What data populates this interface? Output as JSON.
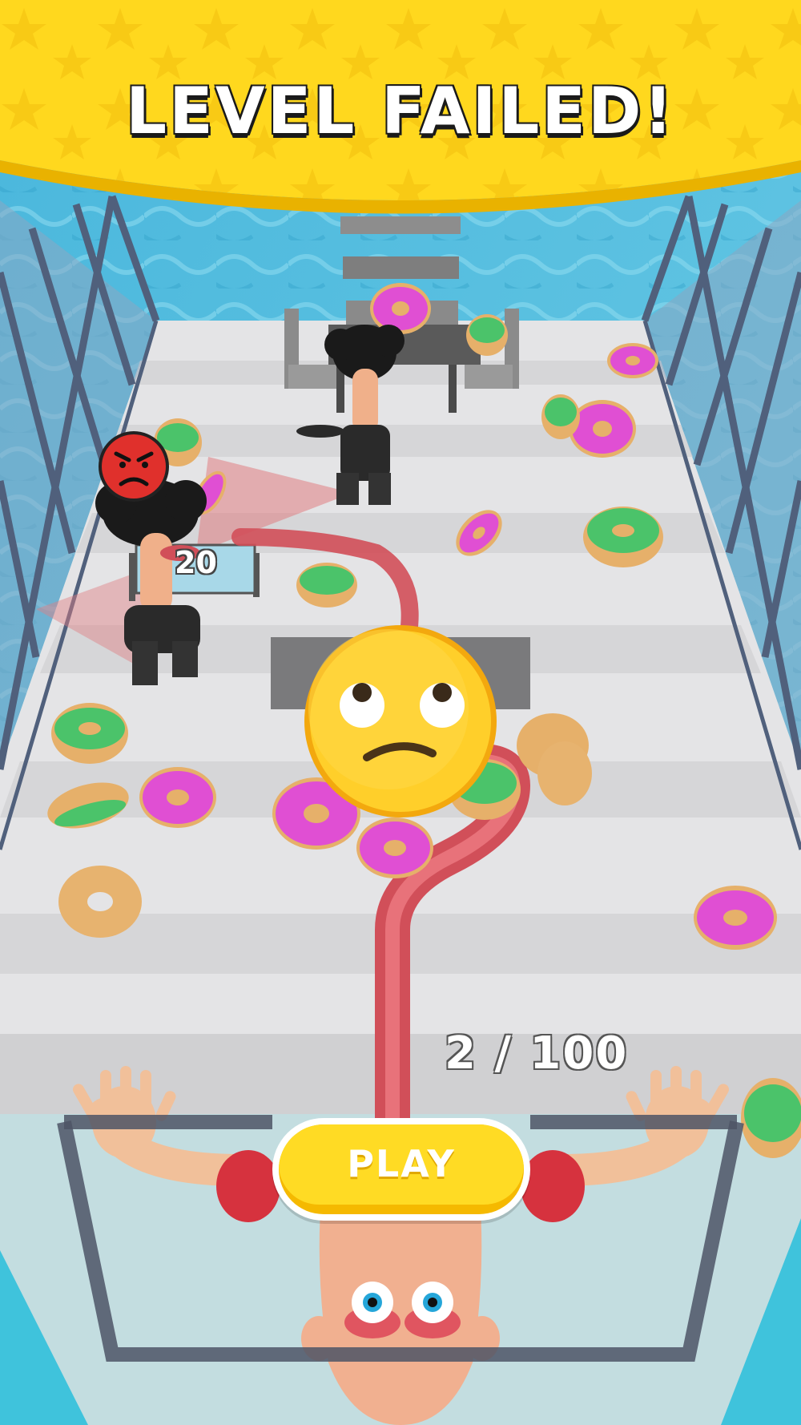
{
  "banner": {
    "title": "LEVEL FAILED!"
  },
  "board": {
    "value": "20"
  },
  "progress": {
    "current": 2,
    "total": 100,
    "text": "2 / 100"
  },
  "play_button": {
    "label": "PLAY"
  },
  "icons": {
    "angry": "angry-emoji-icon",
    "eye_roll": "eye-roll-emoji-icon"
  },
  "colors": {
    "banner": "#ffd81e",
    "water": "#3fb6d6",
    "floor": "#e6e6e8",
    "button": "#ffdb24",
    "tongue": "#e05560"
  }
}
